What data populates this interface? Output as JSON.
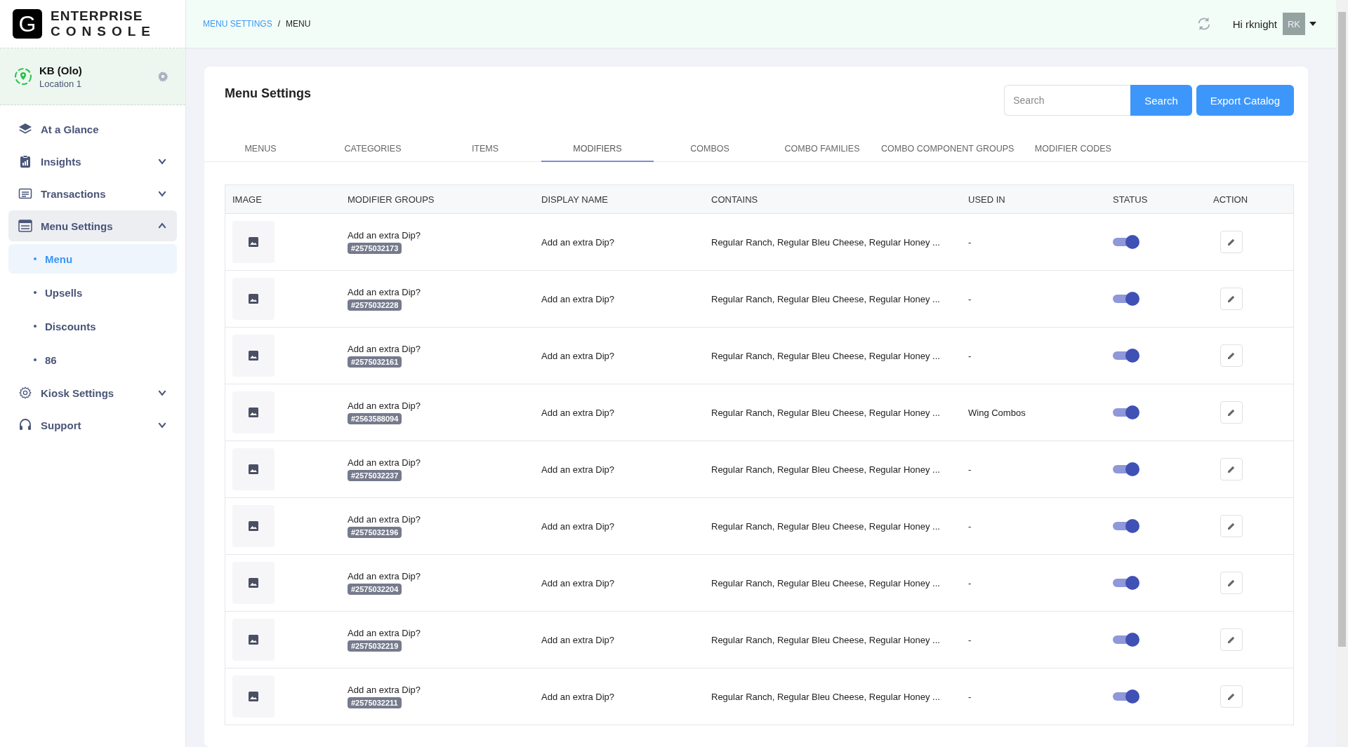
{
  "logo": {
    "letter": "G",
    "line1": "ENTERPRISE",
    "line2": "CONSOLE"
  },
  "location": {
    "name": "KB (Olo)",
    "sub": "Location 1"
  },
  "nav": [
    {
      "label": "At a Glance",
      "kind": "link",
      "selected": false
    },
    {
      "label": "Insights",
      "kind": "group",
      "expanded": false,
      "selected": false
    },
    {
      "label": "Transactions",
      "kind": "group",
      "expanded": false,
      "selected": false
    },
    {
      "label": "Menu Settings",
      "kind": "group",
      "expanded": true,
      "selected": true,
      "children": [
        {
          "label": "Menu",
          "selected": true
        },
        {
          "label": "Upsells",
          "selected": false
        },
        {
          "label": "Discounts",
          "selected": false
        },
        {
          "label": "86",
          "selected": false
        }
      ]
    },
    {
      "label": "Kiosk Settings",
      "kind": "group",
      "expanded": false,
      "selected": false
    },
    {
      "label": "Support",
      "kind": "group",
      "expanded": false,
      "selected": false
    }
  ],
  "breadcrumb": [
    {
      "label": "MENU SETTINGS",
      "kind": "link"
    },
    {
      "label": "/",
      "kind": "separator"
    },
    {
      "label": "MENU",
      "kind": "current"
    }
  ],
  "user": {
    "greeting": "Hi rknight",
    "initials": "RK"
  },
  "page_title": "Menu Settings",
  "search": {
    "placeholder": "Search",
    "button": "Search"
  },
  "export_button": "Export Catalog",
  "tabs": [
    {
      "label": "MENUS",
      "selected": false
    },
    {
      "label": "CATEGORIES",
      "selected": false
    },
    {
      "label": "ITEMS",
      "selected": false
    },
    {
      "label": "MODIFIERS",
      "selected": true
    },
    {
      "label": "COMBOS",
      "selected": false
    },
    {
      "label": "COMBO FAMILIES",
      "selected": false
    },
    {
      "label": "COMBO COMPONENT GROUPS",
      "selected": false
    },
    {
      "label": "MODIFIER CODES",
      "selected": false
    }
  ],
  "table": {
    "columns": [
      "IMAGE",
      "MODIFIER GROUPS",
      "DISPLAY NAME",
      "CONTAINS",
      "USED IN",
      "STATUS",
      "ACTION"
    ],
    "rows": [
      {
        "group": "Add an extra Dip?",
        "code": "#2575032173",
        "display": "Add an extra Dip?",
        "contains": "Regular Ranch, Regular Bleu Cheese, Regular Honey ...",
        "used_in": "-",
        "on": true
      },
      {
        "group": "Add an extra Dip?",
        "code": "#2575032228",
        "display": "Add an extra Dip?",
        "contains": "Regular Ranch, Regular Bleu Cheese, Regular Honey ...",
        "used_in": "-",
        "on": true
      },
      {
        "group": "Add an extra Dip?",
        "code": "#2575032161",
        "display": "Add an extra Dip?",
        "contains": "Regular Ranch, Regular Bleu Cheese, Regular Honey ...",
        "used_in": "-",
        "on": true
      },
      {
        "group": "Add an extra Dip?",
        "code": "#2563588094",
        "display": "Add an extra Dip?",
        "contains": "Regular Ranch, Regular Bleu Cheese, Regular Honey ...",
        "used_in": "Wing Combos",
        "on": true
      },
      {
        "group": "Add an extra Dip?",
        "code": "#2575032237",
        "display": "Add an extra Dip?",
        "contains": "Regular Ranch, Regular Bleu Cheese, Regular Honey ...",
        "used_in": "-",
        "on": true
      },
      {
        "group": "Add an extra Dip?",
        "code": "#2575032196",
        "display": "Add an extra Dip?",
        "contains": "Regular Ranch, Regular Bleu Cheese, Regular Honey ...",
        "used_in": "-",
        "on": true
      },
      {
        "group": "Add an extra Dip?",
        "code": "#2575032204",
        "display": "Add an extra Dip?",
        "contains": "Regular Ranch, Regular Bleu Cheese, Regular Honey ...",
        "used_in": "-",
        "on": true
      },
      {
        "group": "Add an extra Dip?",
        "code": "#2575032219",
        "display": "Add an extra Dip?",
        "contains": "Regular Ranch, Regular Bleu Cheese, Regular Honey ...",
        "used_in": "-",
        "on": true
      },
      {
        "group": "Add an extra Dip?",
        "code": "#2575032211",
        "display": "Add an extra Dip?",
        "contains": "Regular Ranch, Regular Bleu Cheese, Regular Honey ...",
        "used_in": "-",
        "on": true
      }
    ]
  }
}
